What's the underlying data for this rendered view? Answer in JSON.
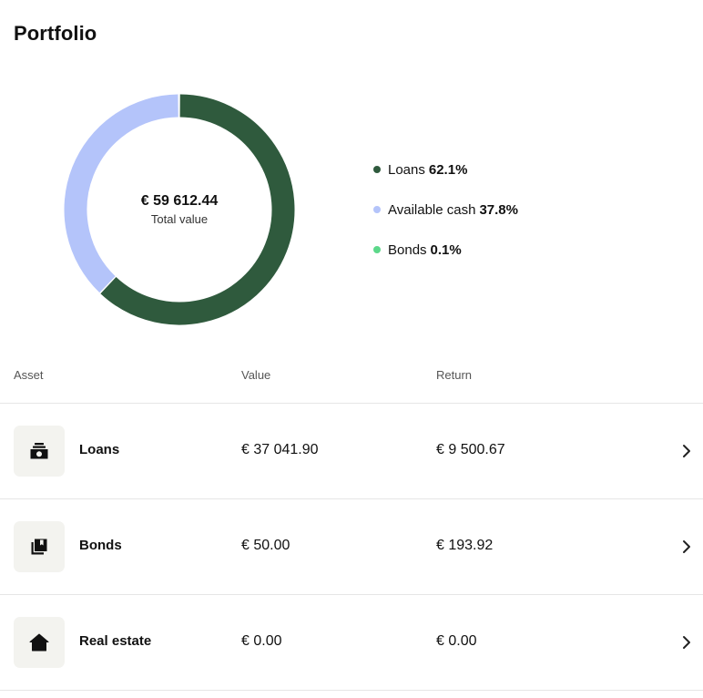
{
  "page": {
    "title": "Portfolio"
  },
  "summary": {
    "total_value": "€ 59 612.44",
    "total_label": "Total value"
  },
  "chart_data": {
    "type": "pie",
    "categories": [
      "Loans",
      "Available cash",
      "Bonds"
    ],
    "values": [
      62.1,
      37.8,
      0.1
    ],
    "colors": [
      "#2f5a3d",
      "#b4c4fa",
      "#5cd88a"
    ],
    "unit": "%"
  },
  "legend": [
    {
      "label": "Loans",
      "pct": "62.1%",
      "color": "#2f5a3d"
    },
    {
      "label": "Available cash",
      "pct": "37.8%",
      "color": "#b4c4fa"
    },
    {
      "label": "Bonds",
      "pct": "0.1%",
      "color": "#5cd88a"
    }
  ],
  "table": {
    "headers": {
      "asset": "Asset",
      "value": "Value",
      "return": "Return"
    },
    "rows": [
      {
        "icon": "cash-icon",
        "name": "Loans",
        "value": "€ 37 041.90",
        "return": "€ 9 500.67"
      },
      {
        "icon": "bonds-icon",
        "name": "Bonds",
        "value": "€ 50.00",
        "return": "€ 193.92"
      },
      {
        "icon": "home-icon",
        "name": "Real estate",
        "value": "€ 0.00",
        "return": "€ 0.00"
      }
    ]
  }
}
